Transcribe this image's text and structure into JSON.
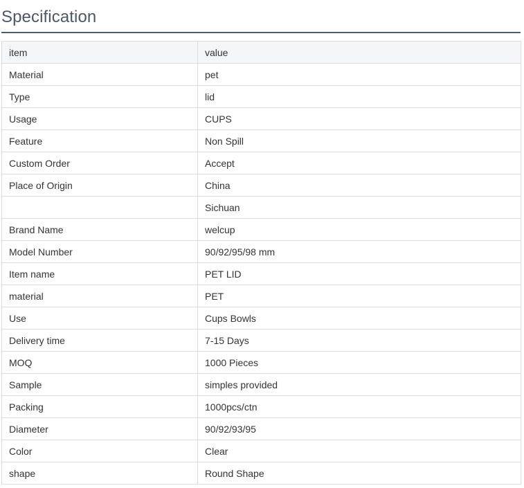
{
  "section": {
    "title": "Specification"
  },
  "table": {
    "header": {
      "item": "item",
      "value": "value"
    },
    "rows": [
      {
        "item": "Material",
        "value": "pet"
      },
      {
        "item": "Type",
        "value": "lid"
      },
      {
        "item": "Usage",
        "value": "CUPS"
      },
      {
        "item": "Feature",
        "value": "Non Spill"
      },
      {
        "item": "Custom Order",
        "value": "Accept"
      },
      {
        "item": "Place of Origin",
        "value": "China"
      },
      {
        "item": "",
        "value": "Sichuan"
      },
      {
        "item": "Brand Name",
        "value": "welcup"
      },
      {
        "item": "Model Number",
        "value": "90/92/95/98 mm"
      },
      {
        "item": "Item name",
        "value": "PET LID"
      },
      {
        "item": "material",
        "value": "PET"
      },
      {
        "item": "Use",
        "value": "Cups Bowls"
      },
      {
        "item": "Delivery time",
        "value": "7-15 Days"
      },
      {
        "item": "MOQ",
        "value": "1000 Pieces"
      },
      {
        "item": "Sample",
        "value": "simples provided"
      },
      {
        "item": "Packing",
        "value": "1000pcs/ctn"
      },
      {
        "item": "Diameter",
        "value": "90/92/93/95"
      },
      {
        "item": "Color",
        "value": "Clear"
      },
      {
        "item": "shape",
        "value": "Round Shape"
      }
    ]
  }
}
